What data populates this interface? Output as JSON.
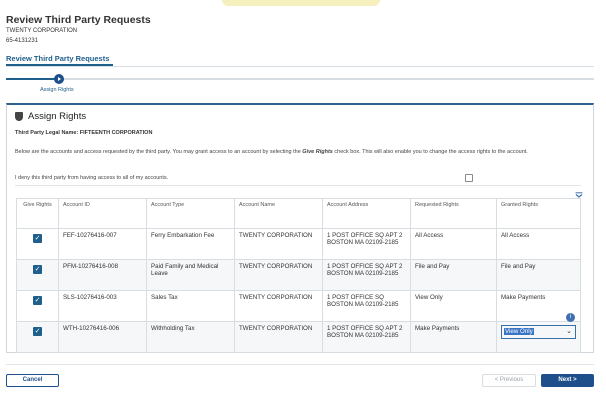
{
  "header": {
    "title": "Review Third Party Requests",
    "org": "TWENTY CORPORATION",
    "id": "65-4131231"
  },
  "subtitle": "Review Third Party Requests",
  "stepper": {
    "step_number": "1",
    "step_label": "Assign Rights"
  },
  "panel": {
    "title": "Assign Rights",
    "legal_name": "Third Party Legal Name: FIFTEENTH CORPORATION",
    "description_before": "Below are the accounts and access requested by the third party. You may grant access to an account by selecting the ",
    "description_bold": "Give Rights",
    "description_after": " check box. This will also enable you to change the access rights to the account.",
    "deny_label": "I deny this third party from having access to all of my accounts."
  },
  "table": {
    "headers": {
      "give_rights": "Give Rights",
      "account_id": "Account ID",
      "account_type": "Account Type",
      "account_name": "Account Name",
      "account_address": "Account Address",
      "requested_rights": "Requested Rights",
      "granted_rights": "Granted Rights"
    },
    "rows": [
      {
        "checked": "✓",
        "account_id": "FEF-10276416-007",
        "account_type": "Ferry Embarkation Fee",
        "account_name": "TWENTY CORPORATION",
        "account_address": "1 POST OFFICE SQ APT 2 BOSTON MA 02109-2185",
        "requested_rights": "All Access",
        "granted_rights": "All Access"
      },
      {
        "checked": "✓",
        "account_id": "PFM-10276416-008",
        "account_type": "Paid Family and Medical Leave",
        "account_name": "TWENTY CORPORATION",
        "account_address": "1 POST OFFICE SQ APT 2 BOSTON MA 02109-2185",
        "requested_rights": "File and Pay",
        "granted_rights": "File and Pay"
      },
      {
        "checked": "✓",
        "account_id": "SLS-10276416-003",
        "account_type": "Sales Tax",
        "account_name": "TWENTY CORPORATION",
        "account_address": "1 POST OFFICE SQ BOSTON MA 02109-2185",
        "requested_rights": "View Only",
        "granted_rights": "Make Payments"
      },
      {
        "checked": "✓",
        "account_id": "WTH-10276416-006",
        "account_type": "Withholding Tax",
        "account_name": "TWENTY CORPORATION",
        "account_address": "1 POST OFFICE SQ APT 2 BOSTON MA 02109-2185",
        "requested_rights": "Make Payments",
        "granted_rights": "View Only"
      }
    ]
  },
  "info_badge": "i",
  "footer": {
    "cancel": "Cancel",
    "previous": "< Previous",
    "next": "Next >"
  },
  "colors": {
    "primary": "#1f4f8b",
    "link": "#1f5f8b",
    "selection": "#3a74c4"
  }
}
